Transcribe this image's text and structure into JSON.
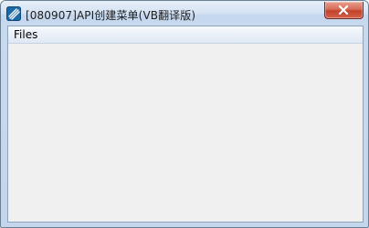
{
  "window": {
    "title": "[080907]API创建菜单(VB翻译版)"
  },
  "menubar": {
    "items": [
      {
        "label": "Files"
      }
    ]
  },
  "colors": {
    "client_background": "#f0f0f0",
    "close_button": "#c4422b",
    "titlebar": "#d6e3f3"
  }
}
